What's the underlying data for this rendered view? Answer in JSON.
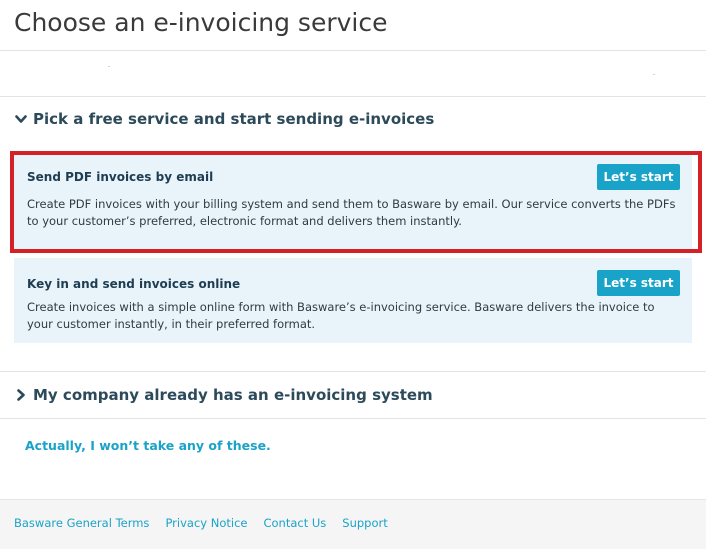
{
  "header": {
    "title": "Choose an e-invoicing service"
  },
  "sections": {
    "free": {
      "label": "Pick a free service and start sending e-invoices",
      "icon": "chevron-down-icon"
    },
    "existing": {
      "label": "My company already has an e-invoicing system",
      "icon": "chevron-right-icon"
    }
  },
  "services": [
    {
      "title": "Send PDF invoices by email",
      "description": "Create PDF invoices with your billing system and send them to Basware by email. Our service converts the PDFs to your customer’s preferred, electronic format and delivers them instantly.",
      "button_label": "Let’s start"
    },
    {
      "title": "Key in and send invoices online",
      "description": "Create invoices with a simple online form with Basware’s e-invoicing service. Basware delivers the invoice to your customer instantly, in their preferred format.",
      "button_label": "Let’s start"
    }
  ],
  "decline_link": "Actually, I won’t take any of these.",
  "footer": {
    "links": [
      "Basware General Terms",
      "Privacy Notice",
      "Contact Us",
      "Support"
    ]
  },
  "colors": {
    "accent": "#1aa3c8",
    "card_background": "#e8f4f9",
    "highlight_border": "#d42027",
    "heading": "#2c4a5a"
  }
}
